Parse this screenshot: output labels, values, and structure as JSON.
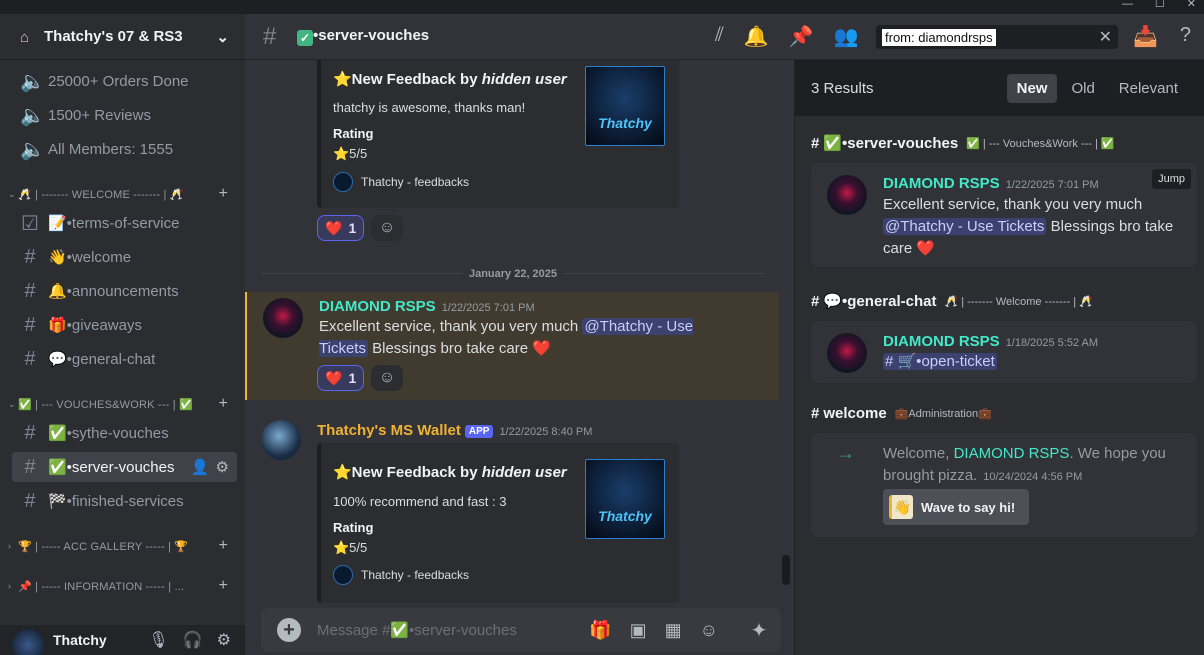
{
  "window": {
    "minimize": "—",
    "maximize": "☐",
    "close": "✕"
  },
  "server": {
    "name": "Thatchy's 07 & RS3"
  },
  "stats": [
    "25000+ Orders Done",
    "1500+ Reviews",
    "All Members: 1555"
  ],
  "categories": {
    "welcome": "🥂 | ------- WELCOME ------- | 🥂",
    "vouches": "✅ | --- VOUCHES&WORK --- | ✅",
    "gallery": "🏆 | ----- ACC GALLERY ----- | 🏆",
    "info": "📌 | ----- INFORMATION ----- | ..."
  },
  "channels": {
    "terms": "📝•terms-of-service",
    "welcome": "👋•welcome",
    "announcements": "🔔•announcements",
    "giveaways": "🎁•giveaways",
    "general": "💬•general-chat",
    "sythe": "✅•sythe-vouches",
    "server_vouches": "✅•server-vouches",
    "finished": "🏁•finished-services"
  },
  "user": {
    "name": "Thatchy"
  },
  "topbar": {
    "channel": "•server-vouches",
    "search_value": "from: diamondrsps"
  },
  "chat": {
    "embed1": {
      "title": "⭐New Feedback by",
      "title_em": "hidden user",
      "desc": "thatchy is awesome, thanks man!",
      "rating_label": "Rating",
      "rating": "⭐5/5",
      "footer": "Thatchy - feedbacks",
      "thumb": "Thatchy"
    },
    "reaction1": {
      "emoji": "❤️",
      "count": "1"
    },
    "date_divider": "January 22, 2025",
    "msg1": {
      "author": "DIAMOND RSPS",
      "time": "1/22/2025 7:01 PM",
      "text_a": "Excellent service, thank you very much ",
      "mention": "@Thatchy - Use Tickets",
      "text_b": " Blessings bro take care ❤️"
    },
    "reaction2": {
      "emoji": "❤️",
      "count": "1"
    },
    "msg2": {
      "author": "Thatchy's MS Wallet",
      "tag": "APP",
      "time": "1/22/2025 8:40 PM"
    },
    "embed2": {
      "title": "⭐New Feedback by",
      "title_em": "hidden user",
      "desc": "100% recommend and fast : 3",
      "rating_label": "Rating",
      "rating": "⭐5/5",
      "footer": "Thatchy - feedbacks",
      "thumb": "Thatchy"
    },
    "composer_placeholder": "Message #✅•server-vouches"
  },
  "results": {
    "count": "3 Results",
    "sort": [
      "New",
      "Old",
      "Relevant"
    ],
    "r1": {
      "channel": "✅•server-vouches",
      "sub": "✅ | --- Vouches&Work --- | ✅",
      "author": "DIAMOND RSPS",
      "time": "1/22/2025 7:01 PM",
      "text_a": "Excellent service, thank you very much ",
      "mention": "@Thatchy - Use Tickets",
      "text_b": " Blessings bro take care ❤️",
      "jump": "Jump"
    },
    "r2": {
      "channel": "💬•general-chat",
      "sub": "🥂 | ------- Welcome ------- | 🥂",
      "author": "DIAMOND RSPS",
      "time": "1/18/2025 5:52 AM",
      "mention": "# 🛒•open-ticket"
    },
    "r3": {
      "channel": "welcome",
      "sub": "💼Administration💼",
      "text_a": "Welcome, ",
      "author": "DIAMOND RSPS",
      "text_b": ". We hope you brought pizza.",
      "time": "10/24/2024 4:56 PM",
      "wave": "Wave to say hi!"
    }
  },
  "colors": {
    "accent": "#5865f2",
    "username_teal": "#43e8c8",
    "bot_gold": "#f0b232",
    "highlight": "#413b2f"
  }
}
